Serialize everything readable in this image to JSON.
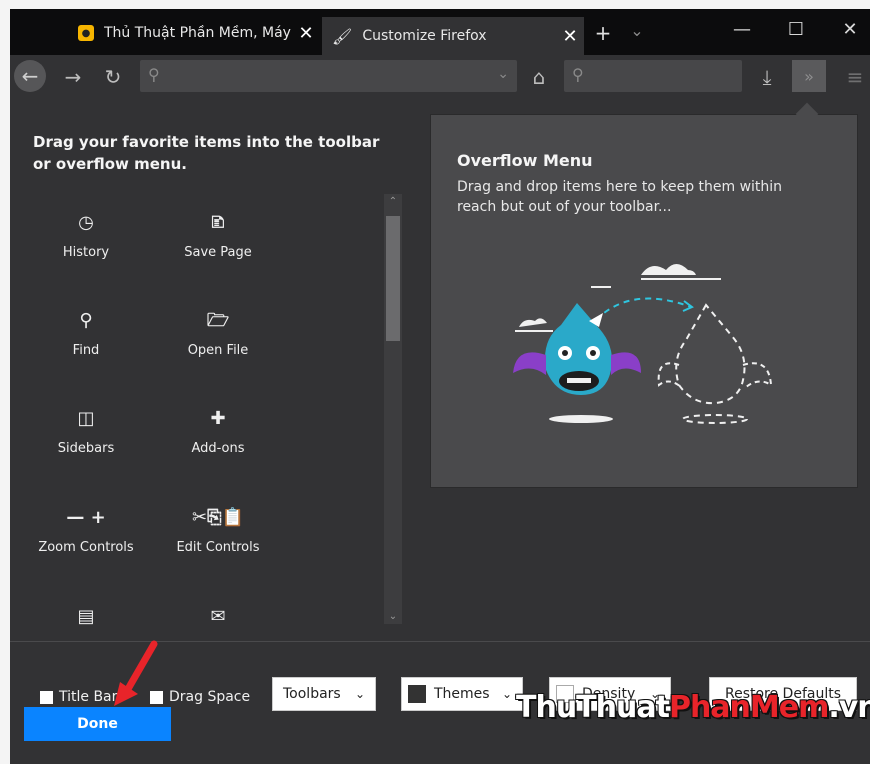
{
  "tabs": [
    {
      "title": "Thủ Thuật Phần Mềm, Máy T",
      "close": "✕"
    },
    {
      "title": "Customize Firefox",
      "close": "✕"
    }
  ],
  "tabbar": {
    "new_tab": "+",
    "tab_list": "⌄"
  },
  "window_controls": {
    "minimize": "—",
    "maximize": "☐",
    "close": "✕"
  },
  "palette": {
    "hint": "Drag your favorite items into the toolbar or overflow menu.",
    "items": [
      {
        "label": "History",
        "icon": "history-icon",
        "glyph": "◷"
      },
      {
        "label": "Save Page",
        "icon": "save-page-icon",
        "glyph": "🗈"
      },
      {
        "label": "Find",
        "icon": "find-icon",
        "glyph": "⚲"
      },
      {
        "label": "Open File",
        "icon": "open-file-icon",
        "glyph": "🗁"
      },
      {
        "label": "Sidebars",
        "icon": "sidebars-icon",
        "glyph": "◫"
      },
      {
        "label": "Add-ons",
        "icon": "addons-icon",
        "glyph": "✚"
      },
      {
        "label": "Zoom Controls",
        "icon": "zoom-controls-icon",
        "glyph": "— +"
      },
      {
        "label": "Edit Controls",
        "icon": "edit-controls-icon",
        "glyph": "✂⎘📋"
      },
      {
        "label": "",
        "icon": "library-icon",
        "glyph": "▤"
      },
      {
        "label": "",
        "icon": "email-icon",
        "glyph": "✉"
      }
    ]
  },
  "overflow_menu": {
    "title": "Overflow Menu",
    "description": "Drag and drop items here to keep them within reach but out of your toolbar..."
  },
  "footer": {
    "title_bar": "Title Bar",
    "drag_space": "Drag Space",
    "toolbars": "Toolbars",
    "themes": "Themes",
    "density": "Density",
    "restore_defaults": "Restore Defaults",
    "done": "Done"
  },
  "watermark": {
    "part1": "ThuThuat",
    "part2": "PhanMem",
    "part3": ".vn"
  },
  "colors": {
    "accent": "#0a84ff",
    "panel": "#4a4a4c",
    "background": "#323234",
    "tabbar": "#0c0c0d"
  }
}
